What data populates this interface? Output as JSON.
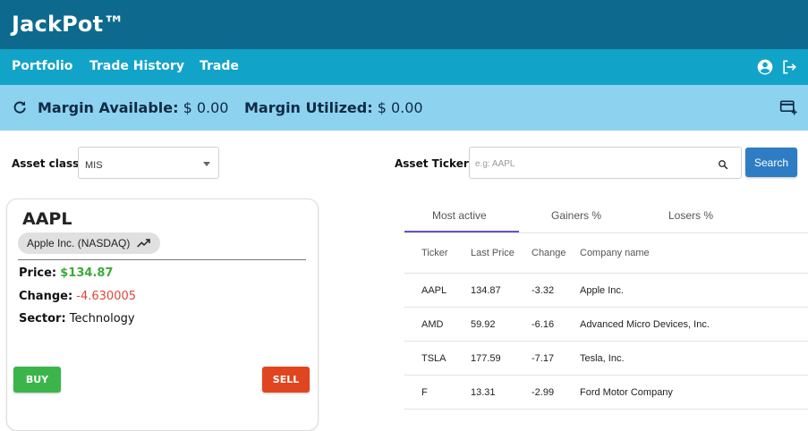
{
  "app": {
    "title": "JackPot™"
  },
  "nav": {
    "items": [
      "Portfolio",
      "Trade History",
      "Trade"
    ],
    "icons": [
      "account-circle-icon",
      "logout-icon"
    ]
  },
  "margin": {
    "available_label": "Margin Available:",
    "available_value": "$ 0.00",
    "utilized_label": "Margin Utilized:",
    "utilized_value": "$ 0.00"
  },
  "filters": {
    "asset_class_label": "Asset class:",
    "asset_class_value": "MIS",
    "ticker_label": "Asset Ticker:",
    "ticker_placeholder": "e.g: AAPL",
    "search_button": "Search"
  },
  "stock_card": {
    "ticker": "AAPL",
    "company_chip": "Apple Inc. (NASDAQ)",
    "price_label": "Price:",
    "price_value": "$134.87",
    "change_label": "Change:",
    "change_value": "-4.630005",
    "sector_label": "Sector:",
    "sector_value": "Technology",
    "buy_label": "BUY",
    "sell_label": "SELL"
  },
  "market_tabs": {
    "tabs": [
      "Most active",
      "Gainers %",
      "Losers %"
    ],
    "active": "Most active"
  },
  "market_table": {
    "columns": [
      "Ticker",
      "Last Price",
      "Change",
      "Company name"
    ],
    "rows": [
      [
        "AAPL",
        "134.87",
        "-3.32",
        "Apple Inc."
      ],
      [
        "AMD",
        "59.92",
        "-6.16",
        "Advanced Micro Devices, Inc."
      ],
      [
        "TSLA",
        "177.59",
        "-7.17",
        "Tesla, Inc."
      ],
      [
        "F",
        "13.31",
        "-2.99",
        "Ford Motor Company"
      ]
    ]
  },
  "colors": {
    "topbar": "#0d6a8e",
    "navbar": "#12a3c9",
    "marginbar": "#8dd3f0",
    "positive": "#3aab3a",
    "negative": "#e0453a",
    "buy": "#3bb54a",
    "sell": "#e0451f",
    "search_button": "#2e7dc4",
    "active_tab": "#6a4fc9"
  }
}
